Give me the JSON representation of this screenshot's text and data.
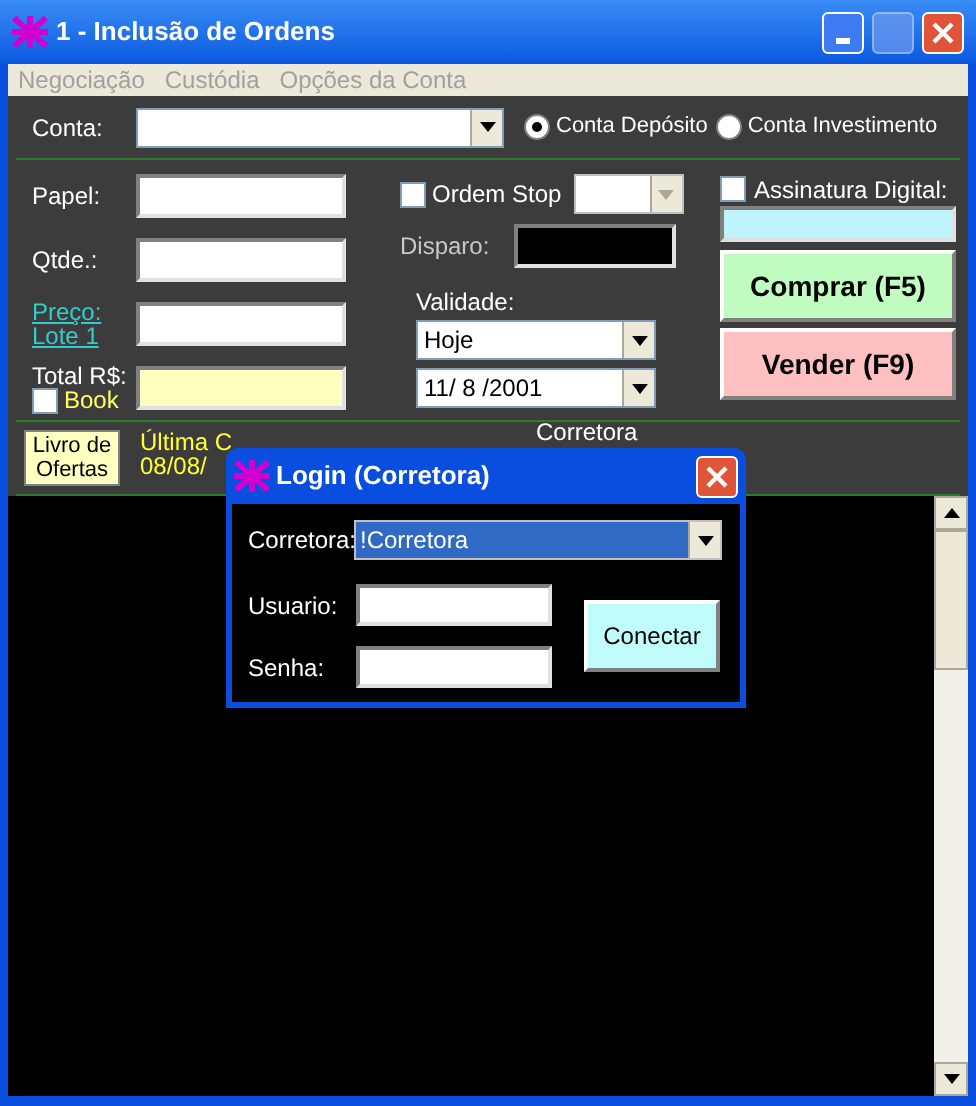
{
  "window": {
    "title": "1 - Inclusão de Ordens"
  },
  "menu": [
    "Negociação",
    "Custódia",
    "Opções da Conta"
  ],
  "account": {
    "label": "Conta:",
    "options": [
      {
        "label": "Conta Depósito",
        "selected": true
      },
      {
        "label": "Conta Investimento",
        "selected": false
      }
    ]
  },
  "form": {
    "papel": "Papel:",
    "qtde": "Qtde.:",
    "preco": "Preço:",
    "lote": "Lote 1",
    "total": "Total R$:",
    "book": {
      "label": "Book",
      "checked": false
    },
    "stop": {
      "label": "Ordem Stop",
      "checked": false
    },
    "disparo": "Disparo:",
    "validade": "Validade:",
    "validity": "Hoje",
    "date": "11/ 8 /2001",
    "signature": {
      "label": "Assinatura Digital:",
      "checked": false
    },
    "buy": "Comprar (F5)",
    "sell": "Vender (F9)"
  },
  "bottom": {
    "book_button": "Livro de Ofertas",
    "last_quote": "Última C",
    "last_date": "08/08/",
    "broker": "Corretora"
  },
  "login": {
    "title": "Login (Corretora)",
    "broker_label": "Corretora:",
    "broker_value": "!Corretora",
    "user_label": "Usuario:",
    "password_label": "Senha:",
    "connect": "Conectar"
  }
}
